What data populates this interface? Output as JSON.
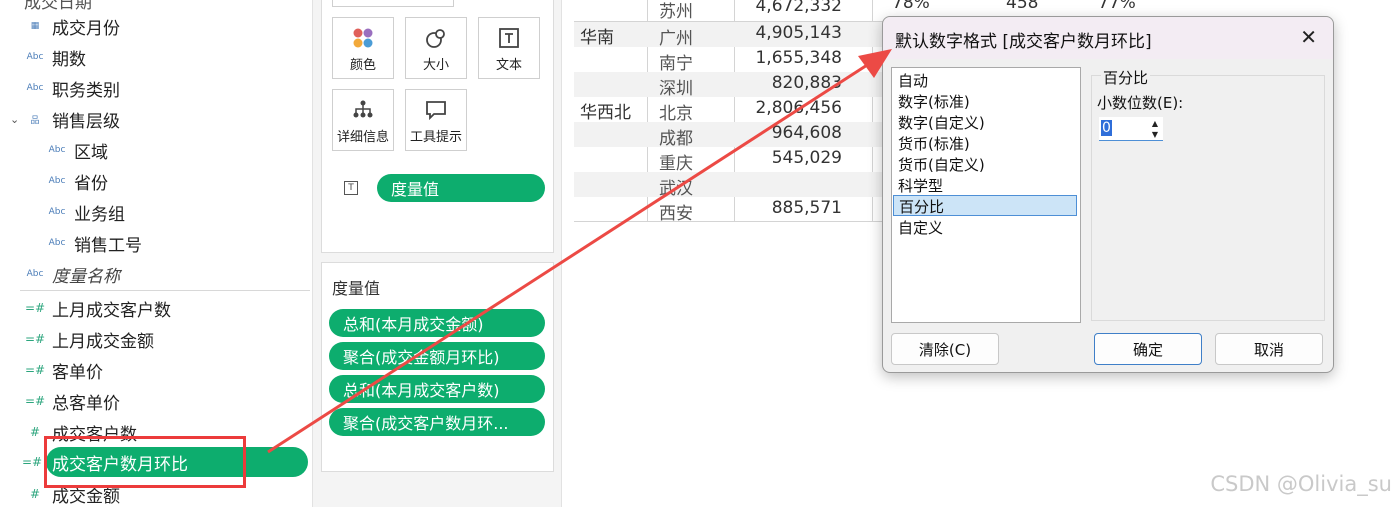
{
  "data_pane": {
    "fields": [
      {
        "icon": "calendar-icon",
        "label": "成交月份"
      },
      {
        "icon": "Abc",
        "label": "期数"
      },
      {
        "icon": "Abc",
        "label": "职务类别"
      },
      {
        "icon": "hierarchy-icon",
        "label": "销售层级"
      },
      {
        "icon": "Abc",
        "label": "区域"
      },
      {
        "icon": "Abc",
        "label": "省份"
      },
      {
        "icon": "Abc",
        "label": "业务组"
      },
      {
        "icon": "Abc",
        "label": "销售工号"
      },
      {
        "icon": "Abc",
        "label": "度量名称"
      },
      {
        "icon": "=#",
        "label": "上月成交客户数"
      },
      {
        "icon": "=#",
        "label": "上月成交金额"
      },
      {
        "icon": "=#",
        "label": "客单价"
      },
      {
        "icon": "=#",
        "label": "总客单价"
      },
      {
        "icon": "#",
        "label": "成交客户数"
      },
      {
        "icon": "=#",
        "label": "成交客户数月环比"
      },
      {
        "icon": "#",
        "label": "成交金额"
      }
    ]
  },
  "marks": {
    "buttons": [
      "颜色",
      "大小",
      "文本",
      "详细信息",
      "工具提示"
    ],
    "text_pill": "度量值"
  },
  "measure_values": {
    "title": "度量值",
    "pills": [
      "总和(本月成交金额)",
      "聚合(成交金额月环比)",
      "总和(本月成交客户数)",
      "聚合(成交客户数月环..."
    ]
  },
  "table": {
    "rows": [
      {
        "region": "",
        "city": "苏州",
        "amount": "4,672,332",
        "pct1": "78%",
        "count": "458",
        "pct2": "77%"
      },
      {
        "region": "华南",
        "city": "广州",
        "amount": "4,905,143",
        "pct1": "",
        "count": "",
        "pct2": ""
      },
      {
        "region": "",
        "city": "南宁",
        "amount": "1,655,348",
        "pct1": "",
        "count": "",
        "pct2": ""
      },
      {
        "region": "",
        "city": "深圳",
        "amount": "820,883",
        "pct1": "",
        "count": "",
        "pct2": ""
      },
      {
        "region": "华西北",
        "city": "北京",
        "amount": "2,806,456",
        "pct1": "",
        "count": "",
        "pct2": ""
      },
      {
        "region": "",
        "city": "成都",
        "amount": "964,608",
        "pct1": "",
        "count": "",
        "pct2": ""
      },
      {
        "region": "",
        "city": "重庆",
        "amount": "545,029",
        "pct1": "",
        "count": "",
        "pct2": ""
      },
      {
        "region": "",
        "city": "武汉",
        "amount": "",
        "pct1": "",
        "count": "",
        "pct2": ""
      },
      {
        "region": "",
        "city": "西安",
        "amount": "885,571",
        "pct1": "",
        "count": "",
        "pct2": ""
      }
    ]
  },
  "dialog": {
    "title": "默认数字格式 [成交客户数月环比]",
    "formats": [
      "自动",
      "数字(标准)",
      "数字(自定义)",
      "货币(标准)",
      "货币(自定义)",
      "科学型",
      "百分比",
      "自定义"
    ],
    "selected": "百分比",
    "group_title": "百分比",
    "decimal_label": "小数位数(E):",
    "decimal_value": "0",
    "clear_button": "清除(C)",
    "ok_button": "确定",
    "cancel_button": "取消"
  },
  "watermark": "CSDN @Olivia_su",
  "colors": {
    "pill_green": "#0dad6e",
    "annotation_red": "#ec3b3b",
    "selection_blue": "#cce4f7"
  }
}
